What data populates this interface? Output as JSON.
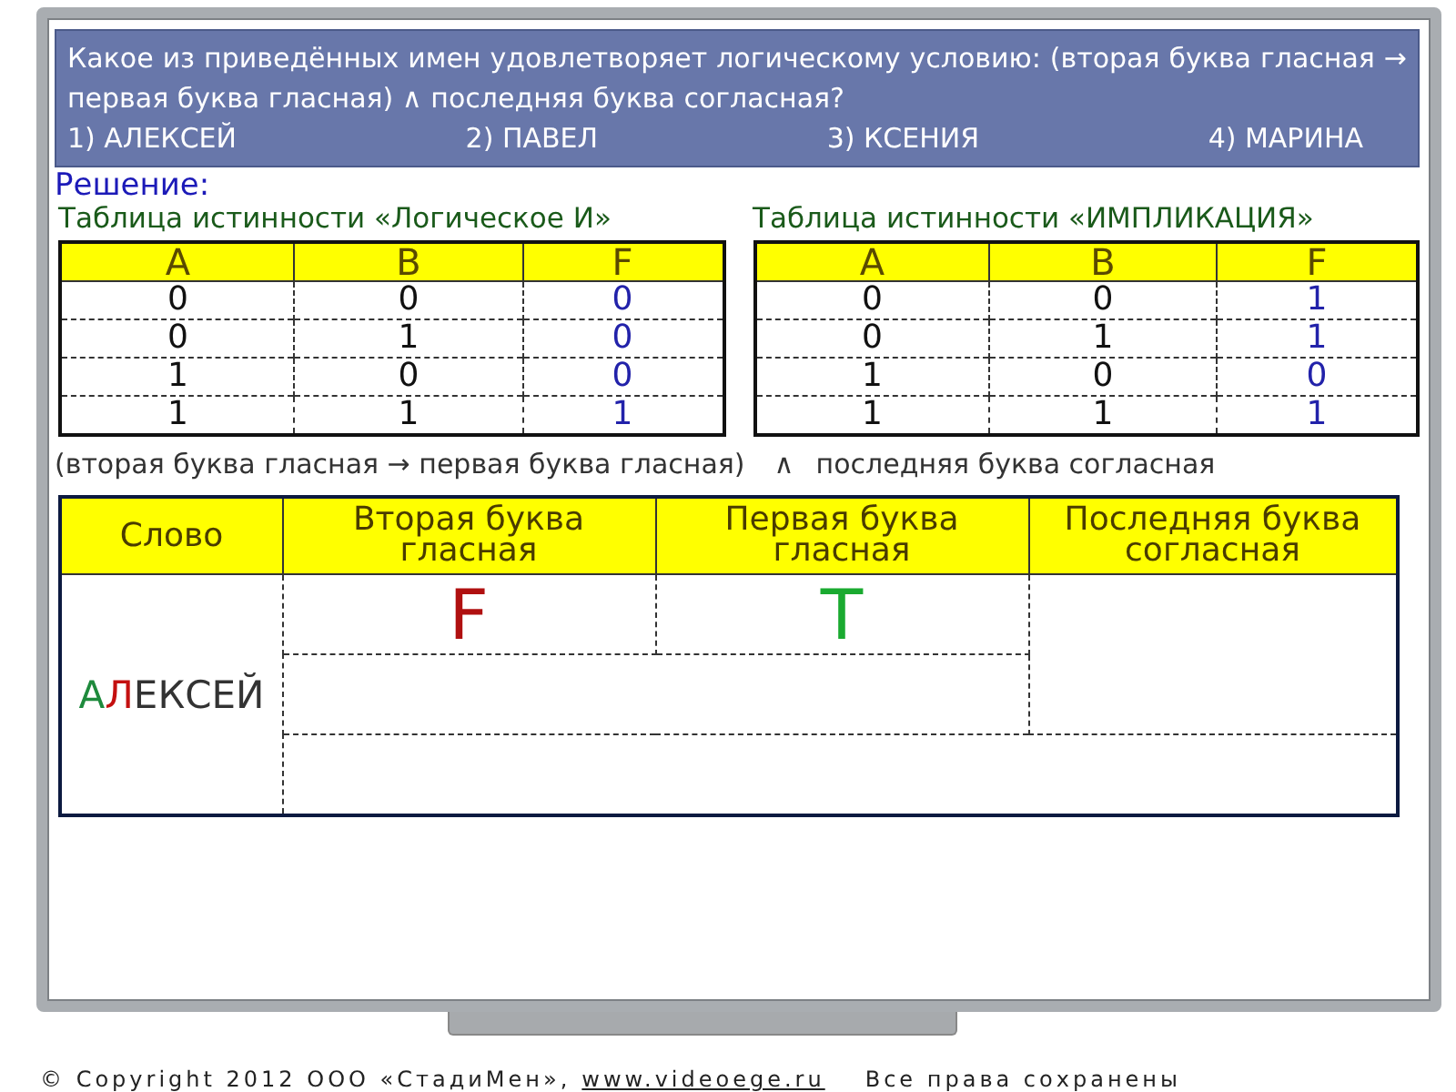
{
  "question": {
    "text": "Какое из приведённых имен удовлетворяет логическому условию: (вторая буква гласная → первая буква гласная) ∧ последняя буква согласная?",
    "options": [
      "1) АЛЕКСЕЙ",
      "2) ПАВЕЛ",
      "3) КСЕНИЯ",
      "4) МАРИНА"
    ]
  },
  "solution_heading": "Решение:",
  "truth_tables": [
    {
      "title": "Таблица истинности «Логическое И»",
      "columns": [
        "A",
        "B",
        "F"
      ],
      "rows": [
        [
          "0",
          "0",
          "0"
        ],
        [
          "0",
          "1",
          "0"
        ],
        [
          "1",
          "0",
          "0"
        ],
        [
          "1",
          "1",
          "1"
        ]
      ]
    },
    {
      "title": "Таблица истинности «ИМПЛИКАЦИЯ»",
      "columns": [
        "A",
        "B",
        "F"
      ],
      "rows": [
        [
          "0",
          "0",
          "1"
        ],
        [
          "0",
          "1",
          "1"
        ],
        [
          "1",
          "0",
          "0"
        ],
        [
          "1",
          "1",
          "1"
        ]
      ]
    }
  ],
  "condition": {
    "left": "(вторая буква гласная → первая буква гласная)",
    "operator": "∧",
    "right": "последняя буква согласная"
  },
  "analysis_table": {
    "columns": [
      "Слово",
      "Вторая буква гласная",
      "Первая буква гласная",
      "Последняя буква согласная"
    ],
    "word": [
      {
        "text": "А",
        "color": "#1e8a3c"
      },
      {
        "text": "Л",
        "color": "#c41010"
      },
      {
        "text": "ЕКСЕЙ",
        "color": "#333333"
      }
    ],
    "results": [
      {
        "text": "F",
        "color": "#b01010"
      },
      {
        "text": "T",
        "color": "#1aaa30"
      }
    ]
  },
  "footer": {
    "copyright": "© Copyright 2012 ООО «СтадиМен»,",
    "link": "www.videoege.ru",
    "rights": "Все права сохранены"
  }
}
